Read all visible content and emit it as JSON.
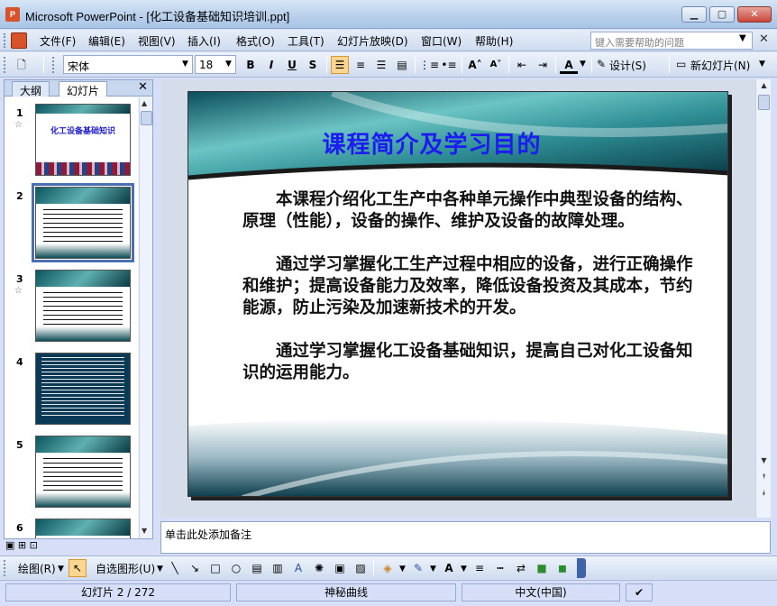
{
  "window": {
    "title": "Microsoft PowerPoint - [化工设备基础知识培训.ppt]",
    "app_icon": "P",
    "controls": [
      "minimize",
      "maximize",
      "close"
    ]
  },
  "menu": {
    "items": [
      "文件(F)",
      "编辑(E)",
      "视图(V)",
      "插入(I)",
      "格式(O)",
      "工具(T)",
      "幻灯片放映(D)",
      "窗口(W)",
      "帮助(H)"
    ],
    "help_placeholder": "键入需要帮助的问题"
  },
  "toolbar": {
    "font_name": "宋体",
    "font_size": "18",
    "bold": "B",
    "italic": "I",
    "underline": "U",
    "shadow": "S",
    "design_label": "设计(S)",
    "new_slide_label": "新幻灯片(N)"
  },
  "left_panel": {
    "tabs": [
      "大纲",
      "幻灯片"
    ],
    "active_tab": "幻灯片",
    "selected_slide": 2,
    "thumbnails": [
      {
        "num": "1",
        "title": "化工设备基础知识"
      },
      {
        "num": "2"
      },
      {
        "num": "3"
      },
      {
        "num": "4"
      },
      {
        "num": "5"
      },
      {
        "num": "6"
      }
    ]
  },
  "slide": {
    "title": "课程简介及学习目的",
    "paragraphs": [
      "本课程介绍化工生产中各种单元操作中典型设备的结构、原理（性能），设备的操作、维护及设备的故障处理。",
      "通过学习掌握化工生产过程中相应的设备，进行正确操作和维护；提高设备能力及效率，降低设备投资及其成本，节约能源，防止污染及加速新技术的开发。",
      "通过学习掌握化工设备基础知识，提高自己对化工设备知识的运用能力。"
    ]
  },
  "notes": {
    "placeholder": "单击此处添加备注"
  },
  "draw_toolbar": {
    "draw_label": "绘图(R)",
    "autoshapes_label": "自选图形(U)"
  },
  "status": {
    "slide_pos": "幻灯片 2 / 272",
    "design": "神秘曲线",
    "language": "中文(中国)"
  }
}
